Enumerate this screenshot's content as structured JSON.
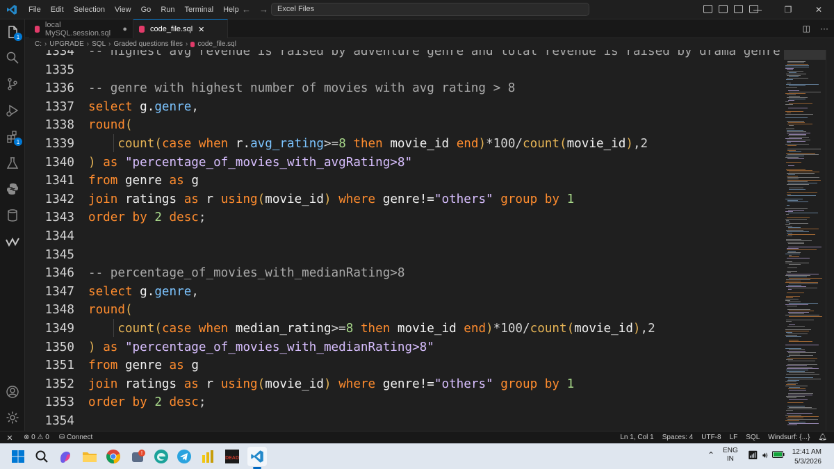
{
  "titlebar": {
    "menu": [
      "File",
      "Edit",
      "Selection",
      "View",
      "Go",
      "Run",
      "Terminal",
      "Help"
    ],
    "search": "Excel Files",
    "colors": {
      "accent": "#0078d4",
      "vscode_blue": "#2489ca"
    }
  },
  "activitybar": {
    "items": [
      "explorer-icon",
      "search-icon",
      "source-control-icon",
      "run-debug-icon",
      "extensions-icon",
      "testing-icon",
      "python-icon",
      "database-icon",
      "windsurf-icon"
    ],
    "explorer_badge": "1",
    "extensions_badge": "1",
    "bottom": [
      "account-icon",
      "settings-icon"
    ]
  },
  "tabs": [
    {
      "label": "local MySQL.session.sql",
      "modified": "●"
    },
    {
      "label": "code_file.sql",
      "close": "✕"
    }
  ],
  "breadcrumb": [
    "C:",
    "UPGRADE",
    "SQL",
    "Graded questions files",
    "code_file.sql"
  ],
  "editor": {
    "lines": [
      {
        "n": "1334",
        "tokens": [
          {
            "c": "cm",
            "t": "-- highest avg revenue is raised by adventure genre and total revenue is raised by drama genre"
          }
        ]
      },
      {
        "n": "1335",
        "tokens": []
      },
      {
        "n": "1336",
        "tokens": [
          {
            "c": "cm",
            "t": "-- genre with highest number of movies with avg rating > 8"
          }
        ]
      },
      {
        "n": "1337",
        "tokens": [
          {
            "c": "kw",
            "t": "select "
          },
          {
            "c": "id",
            "t": "g."
          },
          {
            "c": "al",
            "t": "genre"
          },
          {
            "c": "pr",
            "t": ","
          }
        ]
      },
      {
        "n": "1338",
        "tokens": [
          {
            "c": "kw",
            "t": "round"
          },
          {
            "c": "fn",
            "t": "("
          }
        ]
      },
      {
        "n": "1339",
        "tokens": [
          {
            "c": "pr",
            "t": "    "
          },
          {
            "c": "fn",
            "t": "count("
          },
          {
            "c": "kw",
            "t": "case when "
          },
          {
            "c": "id",
            "t": "r."
          },
          {
            "c": "al",
            "t": "avg_rating"
          },
          {
            "c": "pr",
            "t": ">="
          },
          {
            "c": "num",
            "t": "8 "
          },
          {
            "c": "kw",
            "t": "then "
          },
          {
            "c": "id",
            "t": "movie_id "
          },
          {
            "c": "kw",
            "t": "end"
          },
          {
            "c": "fn",
            "t": ")"
          },
          {
            "c": "pr",
            "t": "*100/"
          },
          {
            "c": "fn",
            "t": "count("
          },
          {
            "c": "id",
            "t": "movie_id"
          },
          {
            "c": "fn",
            "t": ")"
          },
          {
            "c": "pr",
            "t": ",2"
          }
        ]
      },
      {
        "n": "1340",
        "tokens": [
          {
            "c": "fn",
            "t": ") "
          },
          {
            "c": "kw",
            "t": "as "
          },
          {
            "c": "str",
            "t": "\"percentage_of_movies_with_avgRating>8\""
          }
        ]
      },
      {
        "n": "1341",
        "tokens": [
          {
            "c": "kw",
            "t": "from "
          },
          {
            "c": "id",
            "t": "genre "
          },
          {
            "c": "kw",
            "t": "as "
          },
          {
            "c": "id",
            "t": "g"
          }
        ]
      },
      {
        "n": "1342",
        "tokens": [
          {
            "c": "kw",
            "t": "join "
          },
          {
            "c": "id",
            "t": "ratings "
          },
          {
            "c": "kw",
            "t": "as "
          },
          {
            "c": "id",
            "t": "r "
          },
          {
            "c": "kw",
            "t": "using"
          },
          {
            "c": "fn",
            "t": "("
          },
          {
            "c": "id",
            "t": "movie_id"
          },
          {
            "c": "fn",
            "t": ") "
          },
          {
            "c": "kw",
            "t": "where "
          },
          {
            "c": "id",
            "t": "genre!="
          },
          {
            "c": "str",
            "t": "\"others\" "
          },
          {
            "c": "kw",
            "t": "group by "
          },
          {
            "c": "num",
            "t": "1"
          }
        ]
      },
      {
        "n": "1343",
        "tokens": [
          {
            "c": "kw",
            "t": "order by "
          },
          {
            "c": "num",
            "t": "2 "
          },
          {
            "c": "kw",
            "t": "desc"
          },
          {
            "c": "pr",
            "t": ";"
          }
        ]
      },
      {
        "n": "1344",
        "tokens": []
      },
      {
        "n": "1345",
        "tokens": []
      },
      {
        "n": "1346",
        "tokens": [
          {
            "c": "cm",
            "t": "-- percentage_of_movies_with_medianRating>8"
          }
        ]
      },
      {
        "n": "1347",
        "tokens": [
          {
            "c": "kw",
            "t": "select "
          },
          {
            "c": "id",
            "t": "g."
          },
          {
            "c": "al",
            "t": "genre"
          },
          {
            "c": "pr",
            "t": ","
          }
        ]
      },
      {
        "n": "1348",
        "tokens": [
          {
            "c": "kw",
            "t": "round"
          },
          {
            "c": "fn",
            "t": "("
          }
        ]
      },
      {
        "n": "1349",
        "tokens": [
          {
            "c": "pr",
            "t": "    "
          },
          {
            "c": "fn",
            "t": "count("
          },
          {
            "c": "kw",
            "t": "case when "
          },
          {
            "c": "id",
            "t": "median_rating"
          },
          {
            "c": "pr",
            "t": ">="
          },
          {
            "c": "num",
            "t": "8 "
          },
          {
            "c": "kw",
            "t": "then "
          },
          {
            "c": "id",
            "t": "movie_id "
          },
          {
            "c": "kw",
            "t": "end"
          },
          {
            "c": "fn",
            "t": ")"
          },
          {
            "c": "pr",
            "t": "*100/"
          },
          {
            "c": "fn",
            "t": "count("
          },
          {
            "c": "id",
            "t": "movie_id"
          },
          {
            "c": "fn",
            "t": ")"
          },
          {
            "c": "pr",
            "t": ",2"
          }
        ]
      },
      {
        "n": "1350",
        "tokens": [
          {
            "c": "fn",
            "t": ") "
          },
          {
            "c": "kw",
            "t": "as "
          },
          {
            "c": "str",
            "t": "\"percentage_of_movies_with_medianRating>8\""
          }
        ]
      },
      {
        "n": "1351",
        "tokens": [
          {
            "c": "kw",
            "t": "from "
          },
          {
            "c": "id",
            "t": "genre "
          },
          {
            "c": "kw",
            "t": "as "
          },
          {
            "c": "id",
            "t": "g"
          }
        ]
      },
      {
        "n": "1352",
        "tokens": [
          {
            "c": "kw",
            "t": "join "
          },
          {
            "c": "id",
            "t": "ratings "
          },
          {
            "c": "kw",
            "t": "as "
          },
          {
            "c": "id",
            "t": "r "
          },
          {
            "c": "kw",
            "t": "using"
          },
          {
            "c": "fn",
            "t": "("
          },
          {
            "c": "id",
            "t": "movie_id"
          },
          {
            "c": "fn",
            "t": ") "
          },
          {
            "c": "kw",
            "t": "where "
          },
          {
            "c": "id",
            "t": "genre!="
          },
          {
            "c": "str",
            "t": "\"others\" "
          },
          {
            "c": "kw",
            "t": "group by "
          },
          {
            "c": "num",
            "t": "1"
          }
        ]
      },
      {
        "n": "1353",
        "tokens": [
          {
            "c": "kw",
            "t": "order by "
          },
          {
            "c": "num",
            "t": "2 "
          },
          {
            "c": "kw",
            "t": "desc"
          },
          {
            "c": "pr",
            "t": ";"
          }
        ]
      },
      {
        "n": "1354",
        "tokens": []
      }
    ]
  },
  "statusbar": {
    "errors": "0",
    "warnings": "0",
    "connect": "Connect",
    "position": "Ln 1, Col 1",
    "spaces": "Spaces: 4",
    "encoding": "UTF-8",
    "eol": "LF",
    "language": "SQL",
    "windsurf": "Windsurf: {...}"
  },
  "taskbar": {
    "apps": [
      "windows-start-icon",
      "search-icon",
      "copilot-icon",
      "file-explorer-icon",
      "chrome-icon",
      "notification-app-icon",
      "edge-icon",
      "telegram-icon",
      "power-bi-icon",
      "game-app-icon",
      "vscode-icon"
    ],
    "game_label": "DEAD",
    "lang_top": "ENG",
    "lang_bottom": "IN",
    "time": "12:41 AM",
    "date": "5/3/2026"
  }
}
